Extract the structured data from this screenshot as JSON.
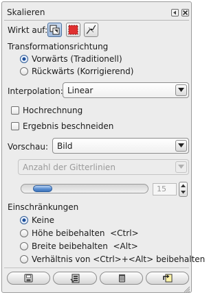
{
  "dialog": {
    "title": "Skalieren",
    "header_buttons": [
      "tab-menu-icon",
      "close-icon"
    ]
  },
  "affects": {
    "label": "Wirkt auf:",
    "targets": [
      {
        "icon": "layer-target-icon",
        "active": true
      },
      {
        "icon": "selection-target-icon",
        "active": false
      },
      {
        "icon": "path-target-icon",
        "active": false
      }
    ]
  },
  "direction": {
    "heading": "Transformationsrichtung",
    "options": [
      {
        "label": "Vorwärts (Traditionell)",
        "selected": true
      },
      {
        "label": "Rückwärts (Korrigierend)",
        "selected": false
      }
    ]
  },
  "interpolation": {
    "label": "Interpolation:",
    "value": "Linear"
  },
  "options": {
    "supersample": {
      "label": "Hochrechnung",
      "checked": false
    },
    "clip_result": {
      "label": "Ergebnis beschneiden",
      "checked": false
    }
  },
  "preview": {
    "label": "Vorschau:",
    "value": "Bild",
    "grid_mode": {
      "value": "Anzahl der Gitterlinien",
      "enabled": false
    },
    "grid_lines": {
      "value": "15",
      "enabled": false
    }
  },
  "constraints": {
    "heading": "Einschränkungen",
    "options": [
      {
        "label": "Keine",
        "selected": true
      },
      {
        "label": "Höhe beibehalten  <Ctrl>",
        "selected": false
      },
      {
        "label": "Breite beibehalten  <Alt>",
        "selected": false
      },
      {
        "label": "Verhältnis von <Ctrl>+<Alt> beibehalten",
        "selected": false
      }
    ]
  },
  "footer": {
    "buttons": [
      "save-options-icon",
      "restore-options-icon",
      "delete-options-icon",
      "reset-options-icon"
    ]
  },
  "colors": {
    "panel": "#ececec",
    "accent": "#3f74bb",
    "radio_on": "#1d4f9b",
    "selection_red": "#e03030",
    "disabled_text": "#9a9a9a"
  }
}
